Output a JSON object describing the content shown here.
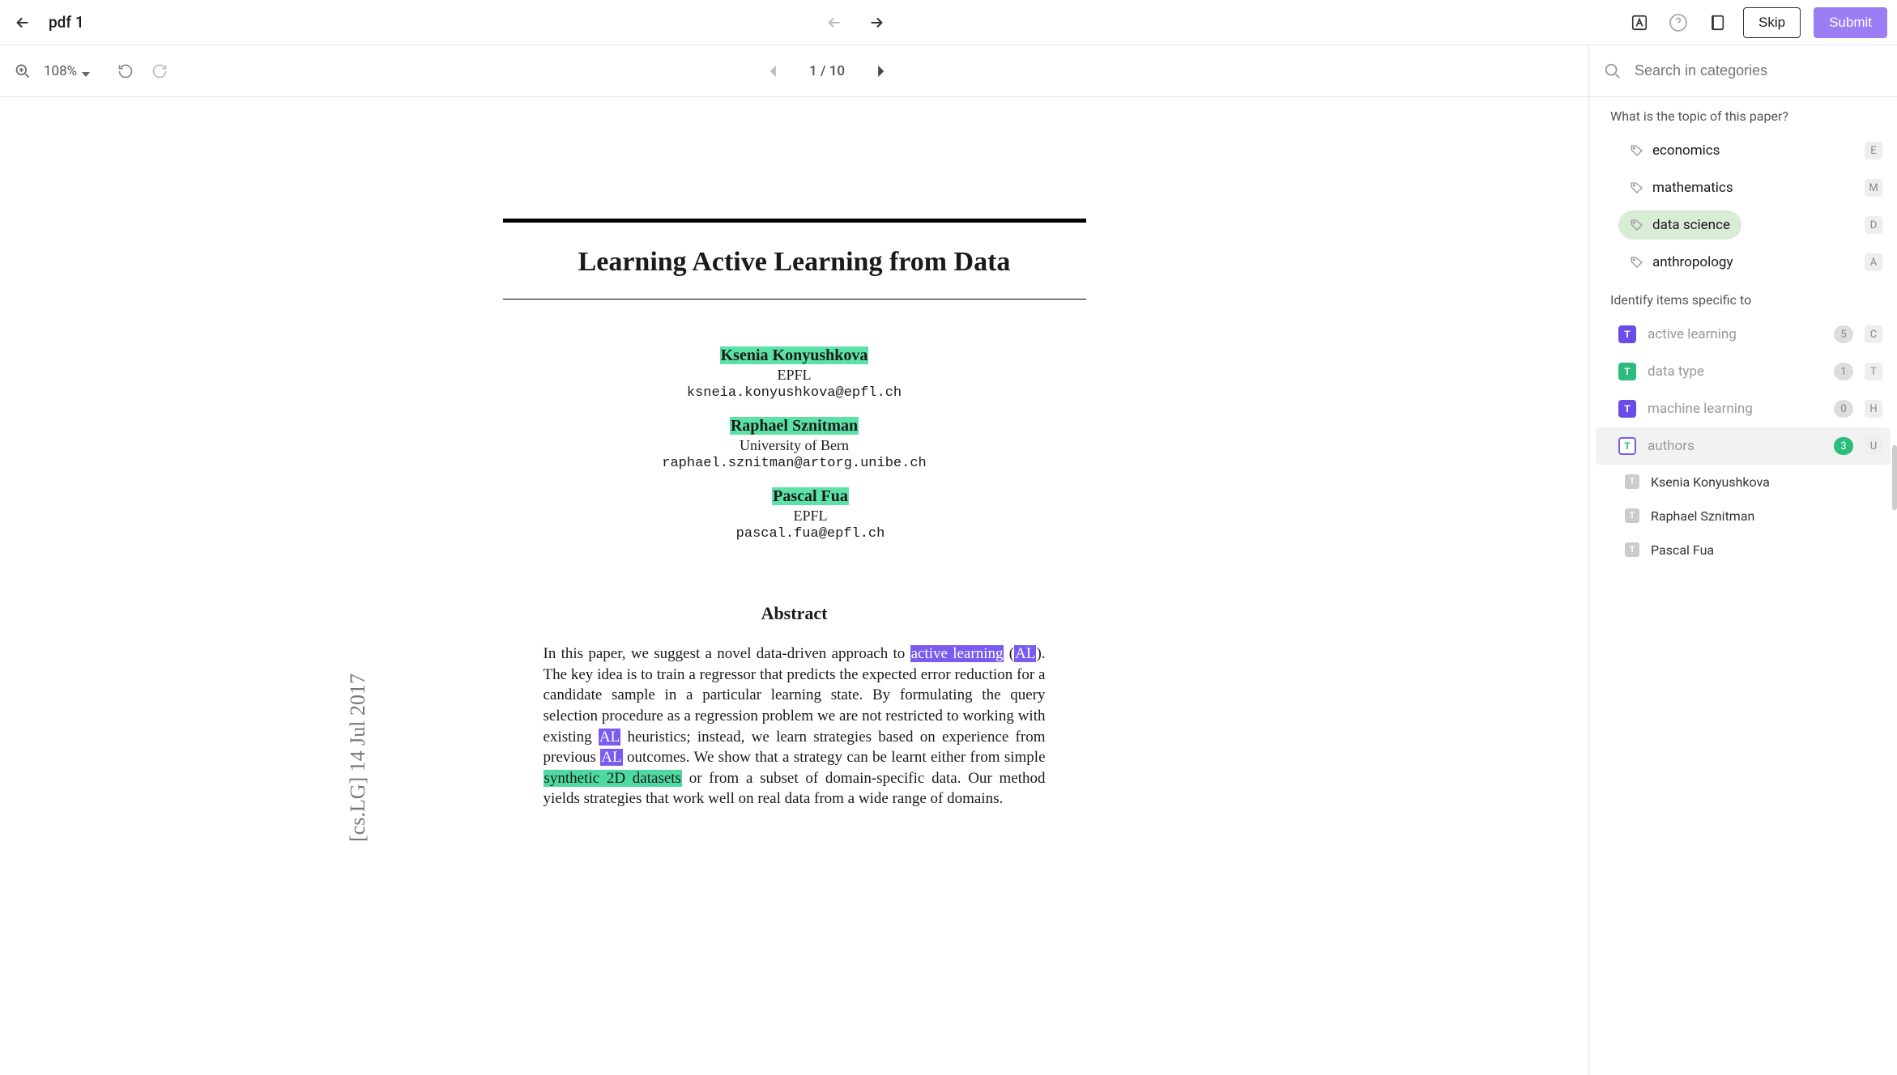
{
  "header": {
    "doc_title": "pdf 1",
    "skip_label": "Skip",
    "submit_label": "Submit"
  },
  "viewer": {
    "zoom": "108%",
    "page_indicator": "1 / 10"
  },
  "paper": {
    "arxiv_tag": "[cs.LG]  14 Jul 2017",
    "title": "Learning Active Learning from Data",
    "authors": [
      {
        "name": "Ksenia Konyushkova",
        "aff": "EPFL",
        "email": "ksneia.konyushkova@epfl.ch"
      },
      {
        "name": "Raphael Sznitman",
        "aff": "University of Bern",
        "email": "raphael.sznitman@artorg.unibe.ch"
      },
      {
        "name": "Pascal Fua",
        "aff": "EPFL",
        "email": "pascal.fua@epfl.ch"
      }
    ],
    "abstract_heading": "Abstract",
    "abs_frag": {
      "p1": "In this paper, we suggest a novel data-driven approach to ",
      "hl1": "active learning",
      "p2": " (",
      "hl2": "AL",
      "p3": "). The key idea is to train a regressor that predicts the expected error reduction for a candidate sample in a particular learning state. By formulating the query selection procedure as a regression problem we are not restricted to working with existing ",
      "hl3": "AL",
      "p4": " heuristics; instead, we learn strategies based on experience from previous ",
      "hl4": "AL",
      "p5": " outcomes. We show that a strategy can be learnt either from simple ",
      "hl5": "synthetic 2D datasets",
      "p6": " or from a subset of domain-specific data. Our method yields strategies that work well on real data from a wide range of domains."
    }
  },
  "sidebar": {
    "search_placeholder": "Search in categories",
    "q1": "What is the topic of this paper?",
    "categories": [
      {
        "label": "economics",
        "key": "E",
        "selected": false
      },
      {
        "label": "mathematics",
        "key": "M",
        "selected": false
      },
      {
        "label": "data science",
        "key": "D",
        "selected": true
      },
      {
        "label": "anthropology",
        "key": "A",
        "selected": false
      }
    ],
    "q2": "Identify items specific to",
    "items": [
      {
        "label": "active learning",
        "count": "5",
        "key": "C",
        "badge": "purple",
        "active": false
      },
      {
        "label": "data type",
        "count": "1",
        "key": "T",
        "badge": "green",
        "active": false
      },
      {
        "label": "machine learning",
        "count": "0",
        "key": "H",
        "badge": "purple",
        "active": false
      },
      {
        "label": "authors",
        "count": "3",
        "key": "U",
        "badge": "green-outline",
        "active": true,
        "count_style": "green"
      }
    ],
    "sub_items": [
      {
        "label": "Ksenia Konyushkova"
      },
      {
        "label": "Raphael Sznitman"
      },
      {
        "label": "Pascal Fua"
      }
    ]
  }
}
